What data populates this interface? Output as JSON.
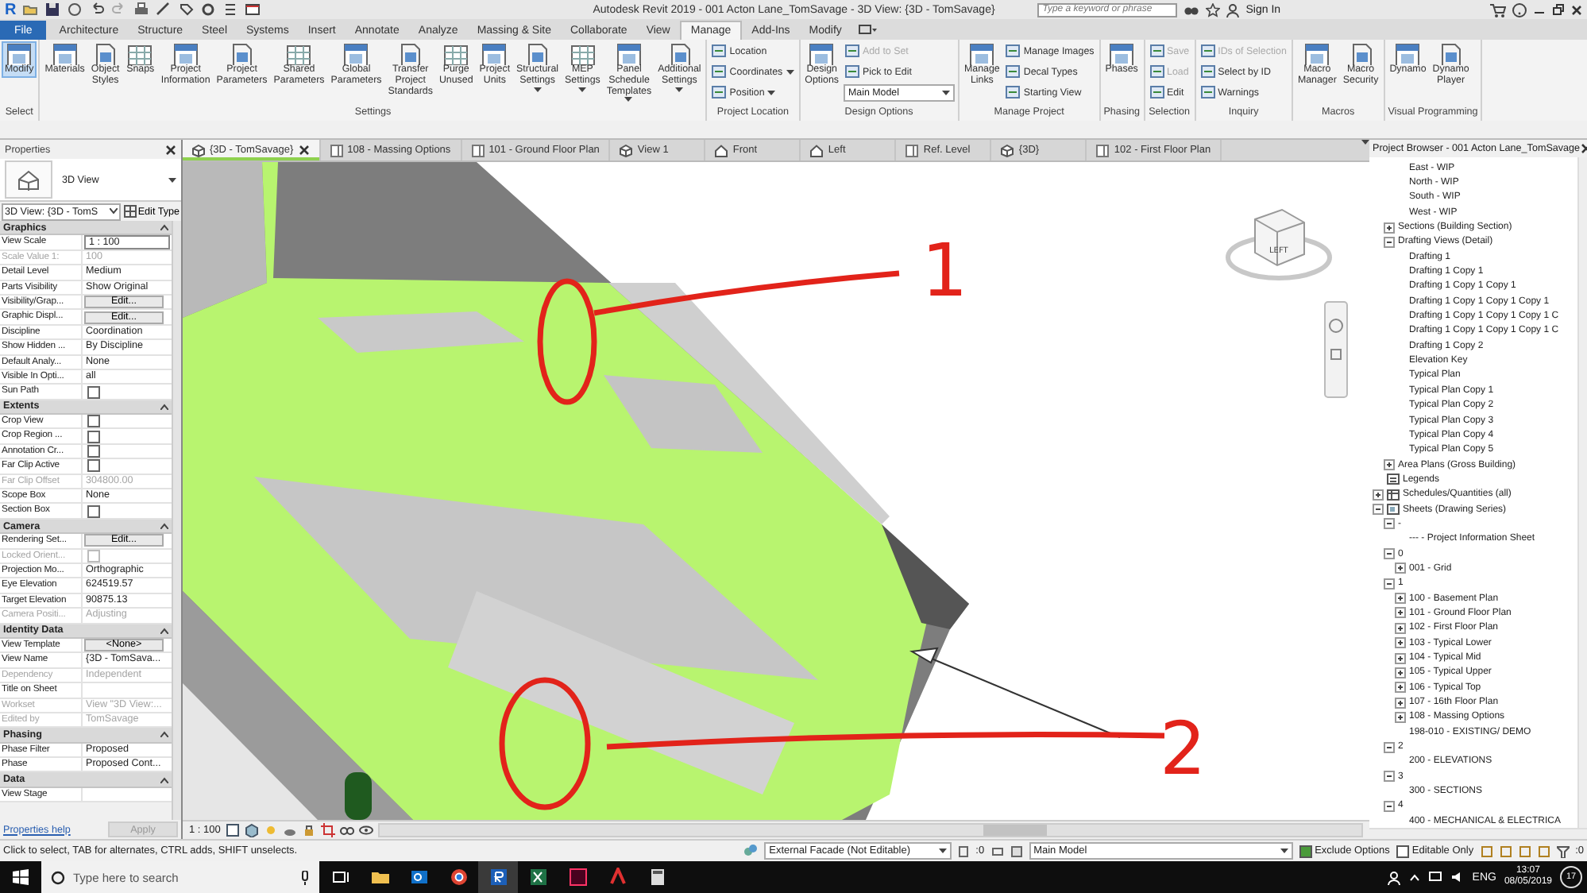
{
  "title_bar": {
    "logo": "R",
    "title": "Autodesk Revit 2019 - 001 Acton Lane_TomSavage - 3D View: {3D - TomSavage}",
    "search": {
      "placeholder": "Type a keyword or phrase"
    },
    "sign_in": "Sign In"
  },
  "ribbon": {
    "file_tab": "File",
    "tabs": [
      {
        "label": "Architecture",
        "selected": false
      },
      {
        "label": "Structure",
        "selected": false
      },
      {
        "label": "Steel",
        "selected": false
      },
      {
        "label": "Systems",
        "selected": false
      },
      {
        "label": "Insert",
        "selected": false
      },
      {
        "label": "Annotate",
        "selected": false
      },
      {
        "label": "Analyze",
        "selected": false
      },
      {
        "label": "Massing & Site",
        "selected": false
      },
      {
        "label": "Collaborate",
        "selected": false
      },
      {
        "label": "View",
        "selected": false
      },
      {
        "label": "Manage",
        "selected": true
      },
      {
        "label": "Add-Ins",
        "selected": false
      },
      {
        "label": "Modify",
        "selected": false
      }
    ],
    "panels": [
      {
        "label": "Select",
        "items": [
          {
            "kind": "large",
            "label": "Modify",
            "active": true
          }
        ]
      },
      {
        "label": "Settings",
        "items": [
          {
            "kind": "large",
            "label": "Materials"
          },
          {
            "kind": "large",
            "label": "Object Styles"
          },
          {
            "kind": "large",
            "label": "Snaps"
          },
          {
            "kind": "large",
            "label": "Project Information"
          },
          {
            "kind": "large",
            "label": "Project Parameters"
          },
          {
            "kind": "large",
            "label": "Shared Parameters"
          },
          {
            "kind": "large",
            "label": "Global Parameters"
          },
          {
            "kind": "large",
            "label": "Transfer Project Standards"
          },
          {
            "kind": "large",
            "label": "Purge Unused"
          },
          {
            "kind": "large",
            "label": "Project Units"
          },
          {
            "kind": "large",
            "label": "Structural Settings",
            "menu": true
          },
          {
            "kind": "large",
            "label": "MEP Settings",
            "menu": true
          },
          {
            "kind": "large",
            "label": "Panel Schedule Templates",
            "menu": true
          },
          {
            "kind": "large",
            "label": "Additional Settings",
            "menu": true
          }
        ]
      },
      {
        "label": "Project Location",
        "items": [
          {
            "kind": "small",
            "label": "Location"
          },
          {
            "kind": "small",
            "label": "Coordinates",
            "menu": true
          },
          {
            "kind": "small",
            "label": "Position",
            "menu": true
          }
        ]
      },
      {
        "label": "Design Options",
        "items": [
          {
            "kind": "large",
            "label": "Design Options",
            "disabled": false
          },
          {
            "kind": "small",
            "label": "Add to Set",
            "disabled": true
          },
          {
            "kind": "small",
            "label": "Pick to Edit",
            "disabled": false
          },
          {
            "kind": "combo",
            "label": "Main Model",
            "disabled": false
          }
        ]
      },
      {
        "label": "Manage Project",
        "items": [
          {
            "kind": "large",
            "label": "Manage Links"
          },
          {
            "kind": "small",
            "label": "Manage Images"
          },
          {
            "kind": "small",
            "label": "Decal Types"
          },
          {
            "kind": "small",
            "label": "Starting View"
          }
        ]
      },
      {
        "label": "Phasing",
        "items": [
          {
            "kind": "large",
            "label": "Phases"
          }
        ]
      },
      {
        "label": "Selection",
        "items": [
          {
            "kind": "small",
            "label": "Save",
            "disabled": true
          },
          {
            "kind": "small",
            "label": "Load",
            "disabled": true
          },
          {
            "kind": "small",
            "label": "Edit",
            "disabled": false
          }
        ]
      },
      {
        "label": "Inquiry",
        "items": [
          {
            "kind": "small",
            "label": "IDs of Selection",
            "disabled": true
          },
          {
            "kind": "small",
            "label": "Select by ID",
            "disabled": false
          },
          {
            "kind": "small",
            "label": "Warnings",
            "disabled": false
          }
        ]
      },
      {
        "label": "Macros",
        "items": [
          {
            "kind": "large",
            "label": "Macro Manager"
          },
          {
            "kind": "large",
            "label": "Macro Security"
          }
        ]
      },
      {
        "label": "Visual Programming",
        "items": [
          {
            "kind": "large",
            "label": "Dynamo"
          },
          {
            "kind": "large",
            "label": "Dynamo Player"
          }
        ]
      }
    ]
  },
  "properties": {
    "title": "Properties",
    "type_name": "3D View",
    "view_selector": "3D View: {3D - TomS",
    "edit_type": "Edit Type",
    "groups": [
      {
        "label": "Graphics",
        "rows": [
          {
            "name": "View Scale",
            "kind": "field",
            "value": "1 : 100",
            "disabled": false
          },
          {
            "name": "Scale Value    1:",
            "kind": "text",
            "value": "100",
            "disabled": true
          },
          {
            "name": "Detail Level",
            "kind": "text",
            "value": "Medium",
            "disabled": false
          },
          {
            "name": "Parts Visibility",
            "kind": "text",
            "value": "Show Original",
            "disabled": false
          },
          {
            "name": "Visibility/Grap...",
            "kind": "button",
            "value": "Edit...",
            "disabled": false
          },
          {
            "name": "Graphic Displ...",
            "kind": "button",
            "value": "Edit...",
            "disabled": false
          },
          {
            "name": "Discipline",
            "kind": "text",
            "value": "Coordination",
            "disabled": false
          },
          {
            "name": "Show Hidden ...",
            "kind": "text",
            "value": "By Discipline",
            "disabled": false
          },
          {
            "name": "Default Analy...",
            "kind": "text",
            "value": "None",
            "disabled": false
          },
          {
            "name": "Visible In Opti...",
            "kind": "text",
            "value": "all",
            "disabled": false
          },
          {
            "name": "Sun Path",
            "kind": "checkbox",
            "checked": false,
            "disabled": false
          }
        ]
      },
      {
        "label": "Extents",
        "rows": [
          {
            "name": "Crop View",
            "kind": "checkbox",
            "checked": false,
            "disabled": false
          },
          {
            "name": "Crop Region ...",
            "kind": "checkbox",
            "checked": false,
            "disabled": false
          },
          {
            "name": "Annotation Cr...",
            "kind": "checkbox",
            "checked": false,
            "disabled": false
          },
          {
            "name": "Far Clip Active",
            "kind": "checkbox",
            "checked": false,
            "disabled": false
          },
          {
            "name": "Far Clip Offset",
            "kind": "text",
            "value": "304800.00",
            "disabled": true
          },
          {
            "name": "Scope Box",
            "kind": "text",
            "value": "None",
            "disabled": false
          },
          {
            "name": "Section Box",
            "kind": "checkbox",
            "checked": false,
            "disabled": false
          }
        ]
      },
      {
        "label": "Camera",
        "rows": [
          {
            "name": "Rendering Set...",
            "kind": "button",
            "value": "Edit...",
            "disabled": false
          },
          {
            "name": "Locked Orient...",
            "kind": "checkbox",
            "checked": false,
            "disabled": true
          },
          {
            "name": "Projection Mo...",
            "kind": "text",
            "value": "Orthographic",
            "disabled": false
          },
          {
            "name": "Eye Elevation",
            "kind": "text",
            "value": "624519.57",
            "disabled": false
          },
          {
            "name": "Target Elevation",
            "kind": "text",
            "value": "90875.13",
            "disabled": false
          },
          {
            "name": "Camera Positi...",
            "kind": "text",
            "value": "Adjusting",
            "disabled": true
          }
        ]
      },
      {
        "label": "Identity Data",
        "rows": [
          {
            "name": "View Template",
            "kind": "button",
            "value": "<None>",
            "disabled": false
          },
          {
            "name": "View Name",
            "kind": "text",
            "value": "{3D - TomSava...",
            "disabled": false
          },
          {
            "name": "Dependency",
            "kind": "text",
            "value": "Independent",
            "disabled": true
          },
          {
            "name": "Title on Sheet",
            "kind": "text",
            "disabled": false
          },
          {
            "name": "Workset",
            "kind": "text",
            "value": "View \"3D View:...",
            "disabled": true
          },
          {
            "name": "Edited by",
            "kind": "text",
            "value": "TomSavage",
            "disabled": true
          }
        ]
      },
      {
        "label": "Phasing",
        "rows": [
          {
            "name": "Phase Filter",
            "kind": "text",
            "value": "Proposed",
            "disabled": false
          },
          {
            "name": "Phase",
            "kind": "text",
            "value": "Proposed Cont...",
            "disabled": false
          }
        ]
      },
      {
        "label": "Data",
        "rows": [
          {
            "name": "View Stage",
            "kind": "text",
            "disabled": false
          }
        ]
      }
    ],
    "help_link": "Properties help",
    "apply": "Apply"
  },
  "view": {
    "tabs": [
      {
        "label": "{3D - TomSavage}",
        "kind": "model",
        "selected": true
      },
      {
        "label": "108 - Massing Options",
        "kind": "sheet",
        "selected": false
      },
      {
        "label": "101 - Ground Floor Plan",
        "kind": "sheet",
        "selected": false
      },
      {
        "label": "View 1",
        "kind": "model",
        "selected": false
      },
      {
        "label": "Front",
        "kind": "elevation",
        "selected": false
      },
      {
        "label": "Left",
        "kind": "elevation",
        "selected": false
      },
      {
        "label": "Ref. Level",
        "kind": "sheet",
        "selected": false
      },
      {
        "label": "{3D}",
        "kind": "model",
        "selected": false
      },
      {
        "label": "102 - First Floor Plan",
        "kind": "sheet",
        "selected": false
      }
    ],
    "markup_labels": [
      "1",
      "2"
    ],
    "viewcube_face": "LEFT",
    "scale": "1 : 100"
  },
  "project_browser": {
    "title": "Project Browser - 001 Acton Lane_TomSavage",
    "tree": [
      {
        "children": [
          {
            "children": [
              {
                "label": "East - WIP"
              },
              {
                "label": "North - WIP"
              },
              {
                "label": "South - WIP"
              },
              {
                "label": "West - WIP"
              }
            ]
          },
          {
            "label": "Sections (Building Section)",
            "expanded": false
          },
          {
            "label": "Drafting Views (Detail)",
            "expanded": true,
            "children": [
              {
                "label": "Drafting 1"
              },
              {
                "label": "Drafting 1 Copy 1"
              },
              {
                "label": "Drafting 1 Copy 1 Copy 1"
              },
              {
                "label": "Drafting 1 Copy 1 Copy 1 Copy 1"
              },
              {
                "label": "Drafting 1 Copy 1 Copy 1 Copy 1 C"
              },
              {
                "label": "Drafting 1 Copy 1 Copy 1 Copy 1 C"
              },
              {
                "label": "Drafting 1 Copy 2"
              },
              {
                "label": "Elevation Key"
              },
              {
                "label": "Typical Plan"
              },
              {
                "label": "Typical Plan Copy 1"
              },
              {
                "label": "Typical Plan Copy 2"
              },
              {
                "label": "Typical Plan Copy 3"
              },
              {
                "label": "Typical Plan Copy 4"
              },
              {
                "label": "Typical Plan Copy 5"
              }
            ]
          },
          {
            "label": "Area Plans (Gross Building)",
            "expanded": false
          }
        ]
      },
      {
        "label": "Legends",
        "kind": "legends"
      },
      {
        "label": "Schedules/Quantities (all)",
        "kind": "schedules",
        "expanded": false
      },
      {
        "label": "Sheets (Drawing Series)",
        "kind": "sheets",
        "expanded": true,
        "children": [
          {
            "label": "-",
            "expanded": true,
            "children": [
              {
                "label": "--- - Project Information Sheet"
              }
            ]
          },
          {
            "label": "0",
            "expanded": true,
            "children": [
              {
                "label": "001 - Grid",
                "expanded": false
              }
            ]
          },
          {
            "label": "1",
            "expanded": true,
            "children": [
              {
                "label": "100 - Basement Plan",
                "expanded": false
              },
              {
                "label": "101 - Ground Floor Plan",
                "expanded": false
              },
              {
                "label": "102 - First Floor Plan",
                "expanded": false
              },
              {
                "label": "103 - Typical Lower",
                "expanded": false
              },
              {
                "label": "104 - Typical Mid",
                "expanded": false
              },
              {
                "label": "105 - Typical Upper",
                "expanded": false
              },
              {
                "label": "106 - Typical Top",
                "expanded": false
              },
              {
                "label": "107 - 16th Floor Plan",
                "expanded": false
              },
              {
                "label": "108 - Massing Options",
                "expanded": false
              },
              {
                "label": "198-010 - EXISTING/ DEMO"
              }
            ]
          },
          {
            "label": "2",
            "expanded": true,
            "children": [
              {
                "label": "200 - ELEVATIONS"
              }
            ]
          },
          {
            "label": "3",
            "expanded": true,
            "children": [
              {
                "label": "300 - SECTIONS"
              }
            ]
          },
          {
            "label": "4",
            "expanded": true,
            "children": [
              {
                "label": "400 - MECHANICAL & ELECTRICA"
              }
            ]
          }
        ]
      }
    ]
  },
  "status_bar": {
    "message": "Click to select, TAB for alternates, CTRL adds, SHIFT unselects.",
    "workset": "External Facade (Not Editable)",
    "workset_count": ":0",
    "design_option": "Main Model",
    "exclude_options": {
      "label": "Exclude Options",
      "checked": true
    },
    "editable_only": {
      "label": "Editable Only",
      "checked": false
    },
    "filter_count": ":0"
  },
  "taskbar": {
    "search": {
      "placeholder": "Type here to search"
    },
    "language": "ENG",
    "time": "13:07",
    "date": "08/05/2019",
    "notifications": "17"
  }
}
